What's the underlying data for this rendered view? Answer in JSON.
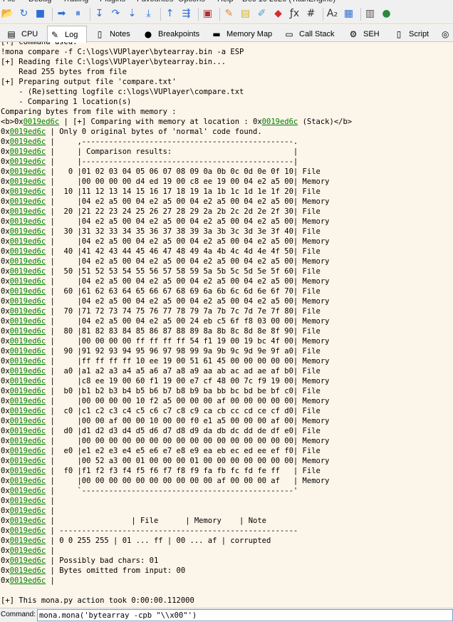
{
  "menu": [
    {
      "label": "File"
    },
    {
      "label": "Debug"
    },
    {
      "label": "Tracing"
    },
    {
      "label": "Plugins"
    },
    {
      "label": "Favourites"
    },
    {
      "label": "Options"
    },
    {
      "label": "Help"
    },
    {
      "label": "Dec 10 2020 (TitanEngine)"
    }
  ],
  "toolbar": [
    {
      "name": "open-icon",
      "glyph": "📂",
      "color": "#d9a520"
    },
    {
      "name": "restart-icon",
      "glyph": "↻",
      "color": "#2e6fd6"
    },
    {
      "name": "stop-icon",
      "glyph": "■",
      "color": "#2e6fd6"
    },
    {
      "name": "sep"
    },
    {
      "name": "run-icon",
      "glyph": "➡",
      "color": "#2e6fd6"
    },
    {
      "name": "pause-icon",
      "glyph": "⏸",
      "color": "#2e6fd6"
    },
    {
      "name": "sep"
    },
    {
      "name": "step-into-icon",
      "glyph": "↧",
      "color": "#2e6fd6"
    },
    {
      "name": "step-over-icon",
      "glyph": "↷",
      "color": "#2e6fd6"
    },
    {
      "name": "trace-into-icon",
      "glyph": "⇣",
      "color": "#2e6fd6"
    },
    {
      "name": "execute-till-return-icon",
      "glyph": "⤓",
      "color": "#2e6fd6"
    },
    {
      "name": "sep"
    },
    {
      "name": "run-to-user-code-icon",
      "glyph": "↑",
      "color": "#2e6fd6"
    },
    {
      "name": "animate-icon",
      "glyph": "⇶",
      "color": "#2e6fd6"
    },
    {
      "name": "sep"
    },
    {
      "name": "scylla-icon",
      "glyph": "▣",
      "color": "#b03030"
    },
    {
      "name": "sep"
    },
    {
      "name": "patch-icon",
      "glyph": "✎",
      "color": "#e09030"
    },
    {
      "name": "comments-icon",
      "glyph": "▤",
      "color": "#d8b020"
    },
    {
      "name": "labels-icon",
      "glyph": "✐",
      "color": "#50a0d0"
    },
    {
      "name": "bookmarks-icon",
      "glyph": "◆",
      "color": "#d03030"
    },
    {
      "name": "functions-icon",
      "glyph": "ƒx",
      "color": "#333333"
    },
    {
      "name": "variables-icon",
      "glyph": "#",
      "color": "#333333"
    },
    {
      "name": "sep"
    },
    {
      "name": "font-size-icon",
      "glyph": "A₂",
      "color": "#333333"
    },
    {
      "name": "log-manager-icon",
      "glyph": "▦",
      "color": "#2e6fd6"
    },
    {
      "name": "sep"
    },
    {
      "name": "calculator-icon",
      "glyph": "▥",
      "color": "#555555"
    },
    {
      "name": "globe-icon",
      "glyph": "●",
      "color": "#2a8a3a"
    }
  ],
  "tabs": [
    {
      "label": "CPU",
      "icon": "▤",
      "icon_name": "cpu-icon",
      "active": false
    },
    {
      "label": "Log",
      "icon": "✎",
      "icon_name": "log-icon",
      "active": true
    },
    {
      "label": "Notes",
      "icon": "▯",
      "icon_name": "notes-icon",
      "active": false
    },
    {
      "label": "Breakpoints",
      "icon": "●",
      "icon_name": "breakpoints-icon",
      "active": false
    },
    {
      "label": "Memory Map",
      "icon": "▬",
      "icon_name": "memory-map-icon",
      "active": false
    },
    {
      "label": "Call Stack",
      "icon": "▭",
      "icon_name": "call-stack-icon",
      "active": false
    },
    {
      "label": "SEH",
      "icon": "⚙",
      "icon_name": "seh-icon",
      "active": false
    },
    {
      "label": "Script",
      "icon": "▯",
      "icon_name": "script-icon",
      "active": false
    },
    {
      "label": "",
      "icon": "◎",
      "icon_name": "symbols-icon",
      "active": false
    }
  ],
  "log": {
    "address": "0x0019ed6c",
    "lines": [
      {
        "text": "[+] Command used:"
      },
      {
        "text": "!mona compare -f C:\\logs\\VUPlayer\\bytearray.bin -a ESP"
      },
      {
        "text": "[+] Reading file C:\\logs\\VUPlayer\\bytearray.bin..."
      },
      {
        "text": "    Read 255 bytes from file"
      },
      {
        "text": "[+] Preparing output file 'compare.txt'"
      },
      {
        "text": "    - (Re)setting logfile c:\\logs\\VUPlayer\\compare.txt"
      },
      {
        "text": "    - Comparing 1 location(s)"
      },
      {
        "text": "Comparing bytes from file with memory :"
      },
      {
        "pre": "<b>0x",
        "link": "0019ed6c",
        "text": " | [+] Comparing with memory at location : 0x",
        "link2": "0019ed6c",
        "post": " (Stack)</b>"
      },
      {
        "link": "0019ed6c",
        "text": " | Only 0 original bytes of 'normal' code found."
      },
      {
        "link": "0019ed6c",
        "text": " |     ,-----------------------------------------------."
      },
      {
        "link": "0019ed6c",
        "text": " |     | Comparison results:                           |"
      },
      {
        "link": "0019ed6c",
        "text": " |     |-----------------------------------------------|"
      },
      {
        "link": "0019ed6c",
        "text": " |   0 |01 02 03 04 05 06 07 08 09 0a 0b 0c 0d 0e 0f 10| File"
      },
      {
        "link": "0019ed6c",
        "text": " |     |00 00 00 00 d4 ed 19 00 c8 ee 19 00 04 e2 a5 00| Memory"
      },
      {
        "link": "0019ed6c",
        "text": " |  10 |11 12 13 14 15 16 17 18 19 1a 1b 1c 1d 1e 1f 20| File"
      },
      {
        "link": "0019ed6c",
        "text": " |     |04 e2 a5 00 04 e2 a5 00 04 e2 a5 00 04 e2 a5 00| Memory"
      },
      {
        "link": "0019ed6c",
        "text": " |  20 |21 22 23 24 25 26 27 28 29 2a 2b 2c 2d 2e 2f 30| File"
      },
      {
        "link": "0019ed6c",
        "text": " |     |04 e2 a5 00 04 e2 a5 00 04 e2 a5 00 04 e2 a5 00| Memory"
      },
      {
        "link": "0019ed6c",
        "text": " |  30 |31 32 33 34 35 36 37 38 39 3a 3b 3c 3d 3e 3f 40| File"
      },
      {
        "link": "0019ed6c",
        "text": " |     |04 e2 a5 00 04 e2 a5 00 04 e2 a5 00 04 e2 a5 00| Memory"
      },
      {
        "link": "0019ed6c",
        "text": " |  40 |41 42 43 44 45 46 47 48 49 4a 4b 4c 4d 4e 4f 50| File"
      },
      {
        "link": "0019ed6c",
        "text": " |     |04 e2 a5 00 04 e2 a5 00 04 e2 a5 00 04 e2 a5 00| Memory"
      },
      {
        "link": "0019ed6c",
        "text": " |  50 |51 52 53 54 55 56 57 58 59 5a 5b 5c 5d 5e 5f 60| File"
      },
      {
        "link": "0019ed6c",
        "text": " |     |04 e2 a5 00 04 e2 a5 00 04 e2 a5 00 04 e2 a5 00| Memory"
      },
      {
        "link": "0019ed6c",
        "text": " |  60 |61 62 63 64 65 66 67 68 69 6a 6b 6c 6d 6e 6f 70| File"
      },
      {
        "link": "0019ed6c",
        "text": " |     |04 e2 a5 00 04 e2 a5 00 04 e2 a5 00 04 e2 a5 00| Memory"
      },
      {
        "link": "0019ed6c",
        "text": " |  70 |71 72 73 74 75 76 77 78 79 7a 7b 7c 7d 7e 7f 80| File"
      },
      {
        "link": "0019ed6c",
        "text": " |     |04 e2 a5 00 04 e2 a5 00 24 eb c5 6f f8 03 00 00| Memory"
      },
      {
        "link": "0019ed6c",
        "text": " |  80 |81 82 83 84 85 86 87 88 89 8a 8b 8c 8d 8e 8f 90| File"
      },
      {
        "link": "0019ed6c",
        "text": " |     |00 00 00 00 ff ff ff ff 54 f1 19 00 19 bc 4f 00| Memory"
      },
      {
        "link": "0019ed6c",
        "text": " |  90 |91 92 93 94 95 96 97 98 99 9a 9b 9c 9d 9e 9f a0| File"
      },
      {
        "link": "0019ed6c",
        "text": " |     |ff ff ff ff 10 ee 19 00 51 61 45 00 00 00 00 00| Memory"
      },
      {
        "link": "0019ed6c",
        "text": " |  a0 |a1 a2 a3 a4 a5 a6 a7 a8 a9 aa ab ac ad ae af b0| File"
      },
      {
        "link": "0019ed6c",
        "text": " |     |c8 ee 19 00 60 f1 19 00 e7 cf 48 00 7c f9 19 00| Memory"
      },
      {
        "link": "0019ed6c",
        "text": " |  b0 |b1 b2 b3 b4 b5 b6 b7 b8 b9 ba bb bc bd be bf c0| File"
      },
      {
        "link": "0019ed6c",
        "text": " |     |00 00 00 00 10 f2 a5 00 00 00 af 00 00 00 00 00| Memory"
      },
      {
        "link": "0019ed6c",
        "text": " |  c0 |c1 c2 c3 c4 c5 c6 c7 c8 c9 ca cb cc cd ce cf d0| File"
      },
      {
        "link": "0019ed6c",
        "text": " |     |00 00 af 00 00 10 00 00 f0 e1 a5 00 00 00 af 00| Memory"
      },
      {
        "link": "0019ed6c",
        "text": " |  d0 |d1 d2 d3 d4 d5 d6 d7 d8 d9 da db dc dd de df e0| File"
      },
      {
        "link": "0019ed6c",
        "text": " |     |00 00 00 00 00 00 00 00 00 00 00 00 00 00 00 00| Memory"
      },
      {
        "link": "0019ed6c",
        "text": " |  e0 |e1 e2 e3 e4 e5 e6 e7 e8 e9 ea eb ec ed ee ef f0| File"
      },
      {
        "link": "0019ed6c",
        "text": " |     |00 52 a3 00 01 00 00 00 01 00 00 00 00 00 00 00| Memory"
      },
      {
        "link": "0019ed6c",
        "text": " |  f0 |f1 f2 f3 f4 f5 f6 f7 f8 f9 fa fb fc fd fe ff   | File"
      },
      {
        "link": "0019ed6c",
        "text": " |     |00 00 00 00 00 00 00 00 00 00 af 00 00 00 af   | Memory"
      },
      {
        "link": "0019ed6c",
        "text": " |     `-----------------------------------------------'"
      },
      {
        "link": "0019ed6c",
        "text": " |"
      },
      {
        "link": "0019ed6c",
        "text": " |"
      },
      {
        "link": "0019ed6c",
        "text": " |                 | File      | Memory    | Note"
      },
      {
        "link": "0019ed6c",
        "text": " | -----------------------------------------------------"
      },
      {
        "link": "0019ed6c",
        "text": " | 0 0 255 255 | 01 ... ff | 00 ... af | corrupted"
      },
      {
        "link": "0019ed6c",
        "text": " |"
      },
      {
        "link": "0019ed6c",
        "text": " | Possibly bad chars: 01"
      },
      {
        "link": "0019ed6c",
        "text": " | Bytes omitted from input: 00"
      },
      {
        "link": "0019ed6c",
        "text": " |"
      },
      {
        "text": ""
      },
      {
        "text": "[+] This mona.py action took 0:00:00.112000"
      }
    ]
  },
  "command": {
    "label": "Command:",
    "value": "mona.mona('bytearray -cpb \"\\\\x00\"')"
  }
}
